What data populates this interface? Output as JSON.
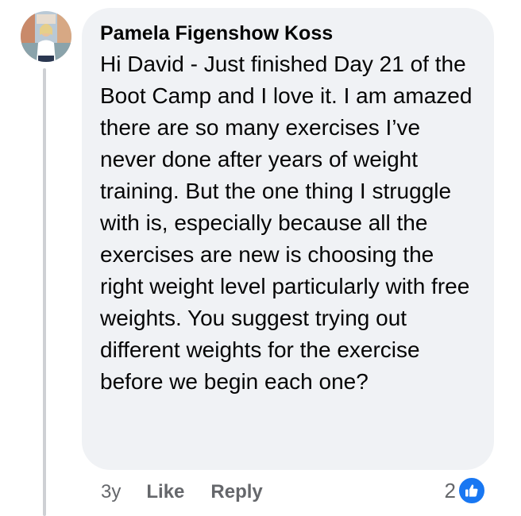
{
  "comment": {
    "author": "Pamela Figenshow Koss",
    "text": "Hi David - Just finished Day 21 of the Boot Camp and I love it. I am amazed there are so many exercises I’ve never done after years of weight training. But the one thing I struggle with is, especially because all the exercises are new is choosing the right weight level particularly with free weights. You suggest trying out different weights for the exercise before we begin each one?",
    "time": "3y",
    "like_label": "Like",
    "reply_label": "Reply",
    "reaction_count": "2"
  },
  "colors": {
    "bubble": "#f0f2f5",
    "like_blue": "#1877f2",
    "meta_gray": "#65676b",
    "thread_line": "#ced0d4"
  }
}
